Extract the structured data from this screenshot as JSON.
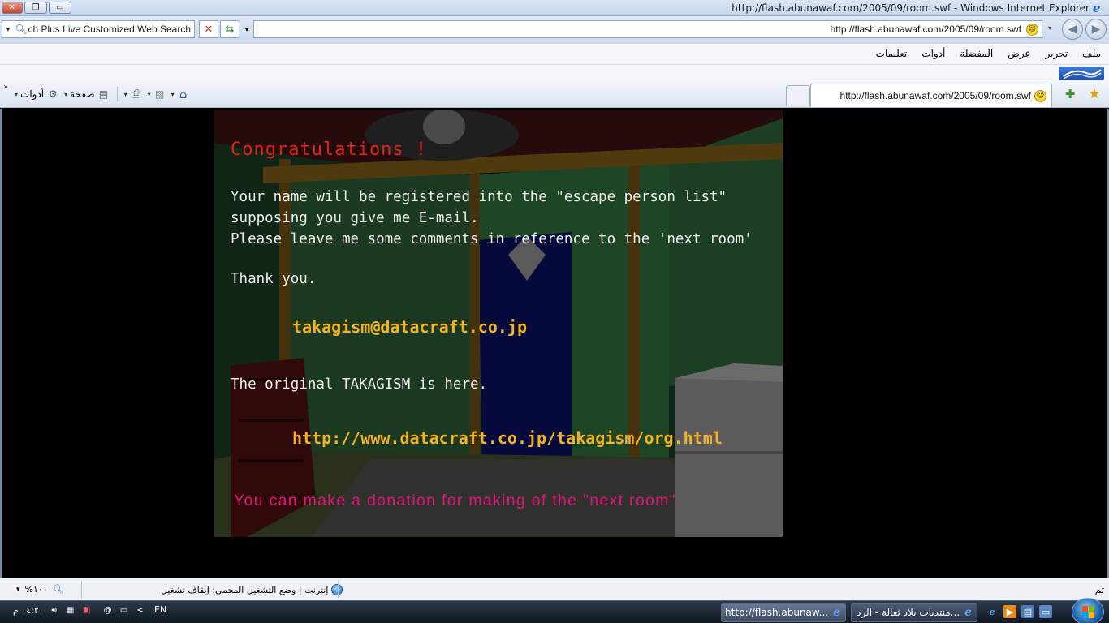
{
  "window": {
    "title": "http://flash.abunawaf.com/2005/09/room.swf - Windows Internet Explorer",
    "close_glyph": "✕",
    "restore_glyph": "❐",
    "minimize_glyph": "▭",
    "ie_logo_glyph": "e"
  },
  "search": {
    "value": "Yahoo Search Plus Live Customized Web Search",
    "icon": "search-icon"
  },
  "toolbar": {
    "stop_glyph": "✕",
    "refresh_glyph": "⇆",
    "back_glyph": "◀",
    "forward_glyph": "▶"
  },
  "address": {
    "url": "http://flash.abunawaf.com/2005/09/room.swf",
    "smiley": "☺"
  },
  "menu": {
    "items": [
      "ملف",
      "تحرير",
      "عرض",
      "المفضلة",
      "أدوات",
      "تعليمات"
    ]
  },
  "command_bar": {
    "chevron": "»",
    "tools_label": "أدوات",
    "page_label": "صفحة",
    "tools_icon": "gear-icon",
    "page_icon": "page-icon",
    "print_icon": "printer-icon",
    "feeds_icon": "rss-icon",
    "home_icon": "home-icon",
    "home_glyph": "⌂",
    "print_glyph": "⎙",
    "gear_glyph": "⚙",
    "page_glyph": "▤",
    "feeds_glyph": "▧",
    "dropdown_glyph": "▾"
  },
  "tabs": [
    {
      "title": "http://flash.abunawaf.com/2005/09/room.swf",
      "active": true
    }
  ],
  "favorites": {
    "add_glyph": "✚",
    "star_glyph": "★"
  },
  "flash": {
    "congrats": "Congratulations !",
    "lines": [
      "Your name will be registered into the \"escape person list\"",
      "supposing you give me E-mail.",
      "Please leave me some comments in reference to the 'next room'"
    ],
    "thanks": "Thank you.",
    "email": "takagism@datacraft.co.jp",
    "original": "The original TAKAGISM is here.",
    "link": "http://www.datacraft.co.jp/takagism/org.html",
    "donation": "You can make a donation for making of the \"next room\".",
    "colors": {
      "congrats": "#e02318",
      "body": "#eeeeee",
      "highlight": "#f4b320",
      "donation": "#e4147c"
    }
  },
  "status": {
    "done": "تم",
    "zone": "إنترنت | وضع التشغيل المحمي: إيقاف تشغيل",
    "zoom": "%١٠٠",
    "zoom_icon": "magnifier-icon"
  },
  "taskbar": {
    "buttons": [
      {
        "label": "منتديات بلاد ثعالة - الرد...",
        "active": false
      },
      {
        "label": "http://flash.abunaw...",
        "active": true
      }
    ],
    "language": "EN",
    "clock": "٠٤:٢٠ م",
    "tray_arrow": "<"
  }
}
